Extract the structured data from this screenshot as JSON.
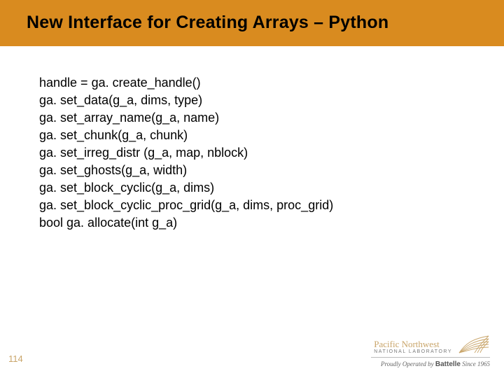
{
  "title": "New Interface for Creating Arrays – Python",
  "code_lines": [
    "handle = ga. create_handle()",
    "ga. set_data(g_a, dims, type)",
    "ga. set_array_name(g_a, name)",
    "ga. set_chunk(g_a, chunk)",
    "ga. set_irreg_distr (g_a, map, nblock)",
    "ga. set_ghosts(g_a, width)",
    "ga. set_block_cyclic(g_a, dims)",
    "ga. set_block_cyclic_proc_grid(g_a, dims, proc_grid)",
    "bool ga. allocate(int g_a)"
  ],
  "page_number": "114",
  "logo": {
    "main": "Pacific Northwest",
    "sub": "NATIONAL LABORATORY"
  },
  "footer_tagline_prefix": "Proudly Operated by ",
  "footer_tagline_brand": "Battelle",
  "footer_tagline_suffix": " Since 1965"
}
